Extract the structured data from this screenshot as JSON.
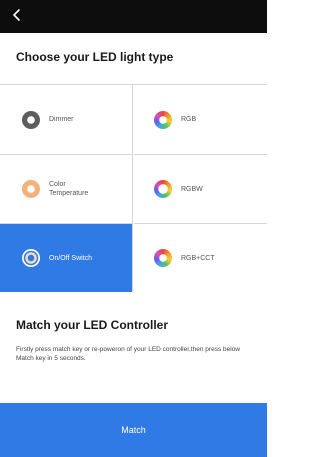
{
  "header": {
    "back_symbol": "<",
    "back_icon": "chevron-left-icon"
  },
  "choose": {
    "title": "Choose your LED light type"
  },
  "light_types": {
    "dimmer": {
      "label": "Dimmer",
      "icon": "dimmer-icon",
      "color": "#5e5e5e"
    },
    "rgb": {
      "label": "RGB",
      "icon": "color-wheel-icon"
    },
    "color_temp": {
      "label": "Color Temperature",
      "icon": "color-temperature-icon",
      "color": "#f4b27a"
    },
    "rgbw": {
      "label": "RGBW",
      "icon": "color-ring-icon"
    },
    "switch": {
      "label": "On/Off Switch",
      "icon": "switch-icon",
      "selected": true
    },
    "rgb_cct": {
      "label": "RGB+CCT",
      "icon": "color-wheel-icon"
    }
  },
  "match": {
    "title": "Match your LED Controller",
    "description": "Firstly press match key or re-poweron of your LED controller,then press below Match key in 5 seconds.",
    "button_label": "Match"
  },
  "colors": {
    "accent": "#2f7ae5",
    "topbar": "#0d0d0d",
    "divider": "#d6d6d6"
  }
}
